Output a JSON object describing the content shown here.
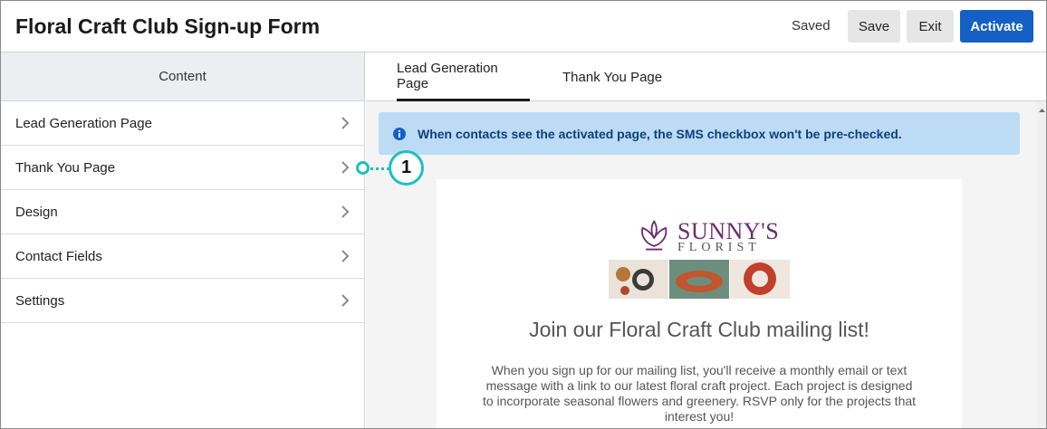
{
  "header": {
    "title": "Floral Craft Club Sign-up Form",
    "status": "Saved",
    "save_label": "Save",
    "exit_label": "Exit",
    "activate_label": "Activate"
  },
  "sidebar": {
    "title": "Content",
    "items": [
      {
        "label": "Lead Generation Page"
      },
      {
        "label": "Thank You Page"
      },
      {
        "label": "Design"
      },
      {
        "label": "Contact Fields"
      },
      {
        "label": "Settings"
      }
    ]
  },
  "tabs": [
    {
      "label": "Lead Generation Page",
      "active": true
    },
    {
      "label": "Thank You Page",
      "active": false
    }
  ],
  "alert": {
    "icon": "info-icon",
    "text": "When contacts see the activated page, the SMS checkbox won't be pre-checked."
  },
  "preview": {
    "logo_name": "SUNNY'S",
    "logo_sub": "FLORIST",
    "heading": "Join our Floral Craft Club mailing list!",
    "body": "When you sign up for our mailing list, you'll receive a monthly email or text message with a link to our latest floral craft project. Each project is designed to incorporate seasonal flowers and greenery. RSVP only for the projects that interest you!"
  },
  "callout": {
    "number": "1"
  },
  "colors": {
    "accent": "#1460c4",
    "callout": "#1ec0c0",
    "alert_bg": "#bcdcf6",
    "brand": "#6b2c6f"
  }
}
